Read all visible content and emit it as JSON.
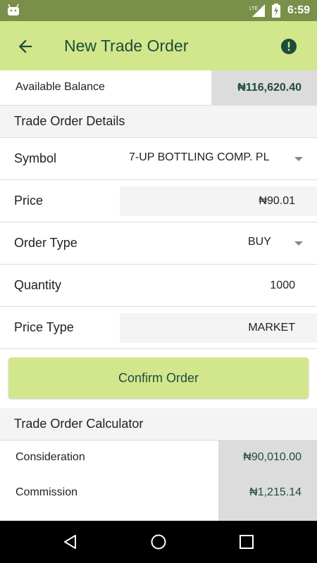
{
  "status_bar": {
    "time": "6:59",
    "network": "LTE"
  },
  "app_bar": {
    "title": "New Trade Order"
  },
  "balance": {
    "label": "Available Balance",
    "value": "₦116,620.40"
  },
  "details_section": {
    "title": "Trade Order Details"
  },
  "form": {
    "symbol": {
      "label": "Symbol",
      "value": "7-UP BOTTLING COMP. PL"
    },
    "price": {
      "label": "Price",
      "value": "₦90.01"
    },
    "order_type": {
      "label": "Order Type",
      "value": "BUY"
    },
    "quantity": {
      "label": "Quantity",
      "value": "1000"
    },
    "price_type": {
      "label": "Price Type",
      "value": "MARKET"
    }
  },
  "confirm_button": {
    "label": "Confirm Order"
  },
  "calculator_section": {
    "title": "Trade Order Calculator"
  },
  "calculator": {
    "rows": [
      {
        "label": "Consideration",
        "value": "₦90,010.00"
      },
      {
        "label": "Commission",
        "value": "₦1,215.14"
      }
    ]
  },
  "colors": {
    "app_bar": "#d2e68c",
    "status_bar": "#7a8f49",
    "accent_text": "#1e4d3a",
    "value_box": "#dcdcdc"
  },
  "icons": [
    "android-icon",
    "lte-signal-icon",
    "battery-icon",
    "back-arrow-icon",
    "alert-icon",
    "nav-back-icon",
    "nav-home-icon",
    "nav-recents-icon"
  ]
}
